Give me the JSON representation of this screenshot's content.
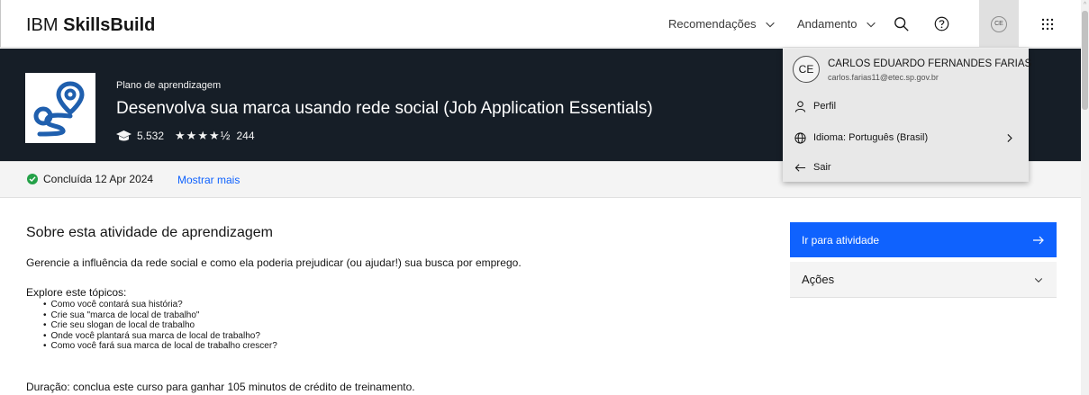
{
  "header": {
    "brand_prefix": "IBM",
    "brand_name": "SkillsBuild",
    "nav_recommendations": "Recomendações",
    "nav_progress": "Andamento",
    "avatar_initials": "CE"
  },
  "hero": {
    "eyebrow": "Plano de aprendizagem",
    "title": "Desenvolva sua marca usando rede social (Job Application Essentials)",
    "learners": "5.532",
    "rating_stars": "★★★★½",
    "rating_count": "244",
    "rating_value": 4.5
  },
  "status": {
    "completed": "Concluída 12 Apr 2024",
    "show_more": "Mostrar mais"
  },
  "main": {
    "title": "Sobre esta atividade de aprendizagem",
    "description": "Gerencie a influência da rede social e como ela poderia prejudicar (ou ajudar!) sua busca por emprego.",
    "explore_heading": "Explore este tópicos:",
    "topics": [
      "Como você contará sua história?",
      "Crie sua \"marca de local de trabalho\"",
      "Crie seu slogan de local de trabalho",
      "Onde você plantará sua marca de local de trabalho?",
      "Como você fará sua marca de local de trabalho crescer?"
    ],
    "duration": "Duração: conclua este curso para ganhar 105 minutos de crédito de treinamento."
  },
  "sidebar": {
    "go_to_activity": "Ir para atividade",
    "actions": "Ações"
  },
  "profile_menu": {
    "initials": "CE",
    "name": "CARLOS EDUARDO FERNANDES FARIAS",
    "email": "carlos.farias11@etec.sp.gov.br",
    "profile": "Perfil",
    "language": "Idioma: Português (Brasil)",
    "logout": "Sair"
  },
  "colors": {
    "hero_bg": "#161e27",
    "primary": "#0f62fe",
    "success": "#24a148",
    "logo_blue": "#1f5fae"
  }
}
